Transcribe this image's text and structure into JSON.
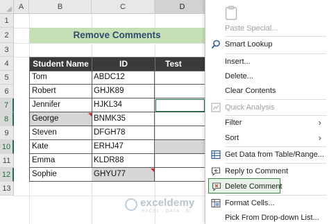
{
  "columns": [
    "A",
    "B",
    "C",
    "D"
  ],
  "rows": [
    "1",
    "2",
    "3",
    "4",
    "5",
    "6",
    "7",
    "8",
    "9",
    "10",
    "11",
    "12",
    "13"
  ],
  "title": "Remove Comments",
  "table": {
    "headers": [
      "Student Name",
      "ID",
      "Test Score"
    ],
    "rows": [
      {
        "name": "Tom",
        "id": "ABDC12",
        "score": ""
      },
      {
        "name": "Robert",
        "id": "GHJK89",
        "score": ""
      },
      {
        "name": "Jennifer",
        "id": "HJKL34",
        "score": ""
      },
      {
        "name": "George",
        "id": "BNMK35",
        "score": ""
      },
      {
        "name": "Steven",
        "id": "DFGH78",
        "score": ""
      },
      {
        "name": "Kate",
        "id": "ERHJ47",
        "score": ""
      },
      {
        "name": "Emma",
        "id": "KLDR88",
        "score": ""
      },
      {
        "name": "Sophie",
        "id": "GHYU77",
        "score": ""
      }
    ]
  },
  "watermark": {
    "name": "exceldemy",
    "tagline": "EXCEL · DATA · BI"
  },
  "context_menu": {
    "items": [
      {
        "label": "Paste Special...",
        "icon": "clipboard-icon",
        "disabled": true
      },
      {
        "label": "Smart Lookup",
        "icon": "search-icon",
        "disabled": false
      },
      {
        "label": "Insert...",
        "icon": "",
        "disabled": false
      },
      {
        "label": "Delete...",
        "icon": "",
        "disabled": false
      },
      {
        "label": "Clear Contents",
        "icon": "",
        "disabled": false
      },
      {
        "label": "Quick Analysis",
        "icon": "quick-analysis-icon",
        "disabled": true
      },
      {
        "label": "Filter",
        "icon": "",
        "disabled": false,
        "submenu": true
      },
      {
        "label": "Sort",
        "icon": "",
        "disabled": false,
        "submenu": true
      },
      {
        "label": "Get Data from Table/Range...",
        "icon": "table-icon",
        "disabled": false
      },
      {
        "label": "Reply to Comment",
        "icon": "reply-comment-icon",
        "disabled": false
      },
      {
        "label": "Delete Comment",
        "icon": "delete-comment-icon",
        "disabled": false,
        "highlighted": true
      },
      {
        "label": "Format Cells...",
        "icon": "format-cells-icon",
        "disabled": false
      },
      {
        "label": "Pick From Drop-down List...",
        "icon": "",
        "disabled": false
      }
    ]
  },
  "colors": {
    "accent": "#217346",
    "title_fill": "#c5e0b4",
    "header_fill": "#3a3a3a",
    "comment_marker": "#e02020",
    "highlight_border": "#2e8b3e"
  }
}
